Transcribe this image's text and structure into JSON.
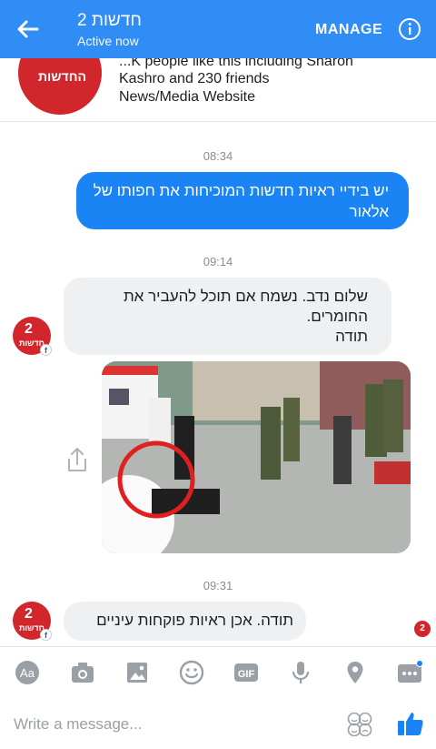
{
  "header": {
    "title": "חדשות 2",
    "subtitle": "Active now",
    "manage_label": "MANAGE"
  },
  "page_card": {
    "logo_text": "החדשות",
    "likes_text": "...K people like this including Sharon Kashro and 230 friends",
    "category": "News/Media Website"
  },
  "messages": {
    "ts1": "08:34",
    "out1": "יש בידיי ראיות חדשות המוכיחות את חפותו של אלאור",
    "ts2": "09:14",
    "in1_line1": "שלום נדב. נשמח אם תוכל להעביר את",
    "in1_line2": "החומרים.",
    "in1_line3": "תודה",
    "ts3": "09:31",
    "in2": "תודה. אכן ראיות פוקחות עיניים"
  },
  "avatar": {
    "number": "2",
    "label": "חדשות"
  },
  "composer": {
    "placeholder": "Write a message..."
  },
  "colors": {
    "header": "#2f8df5",
    "outgoing_bubble": "#1b84f5",
    "incoming_bubble": "#eff0f2",
    "brand_red": "#d0262c"
  }
}
